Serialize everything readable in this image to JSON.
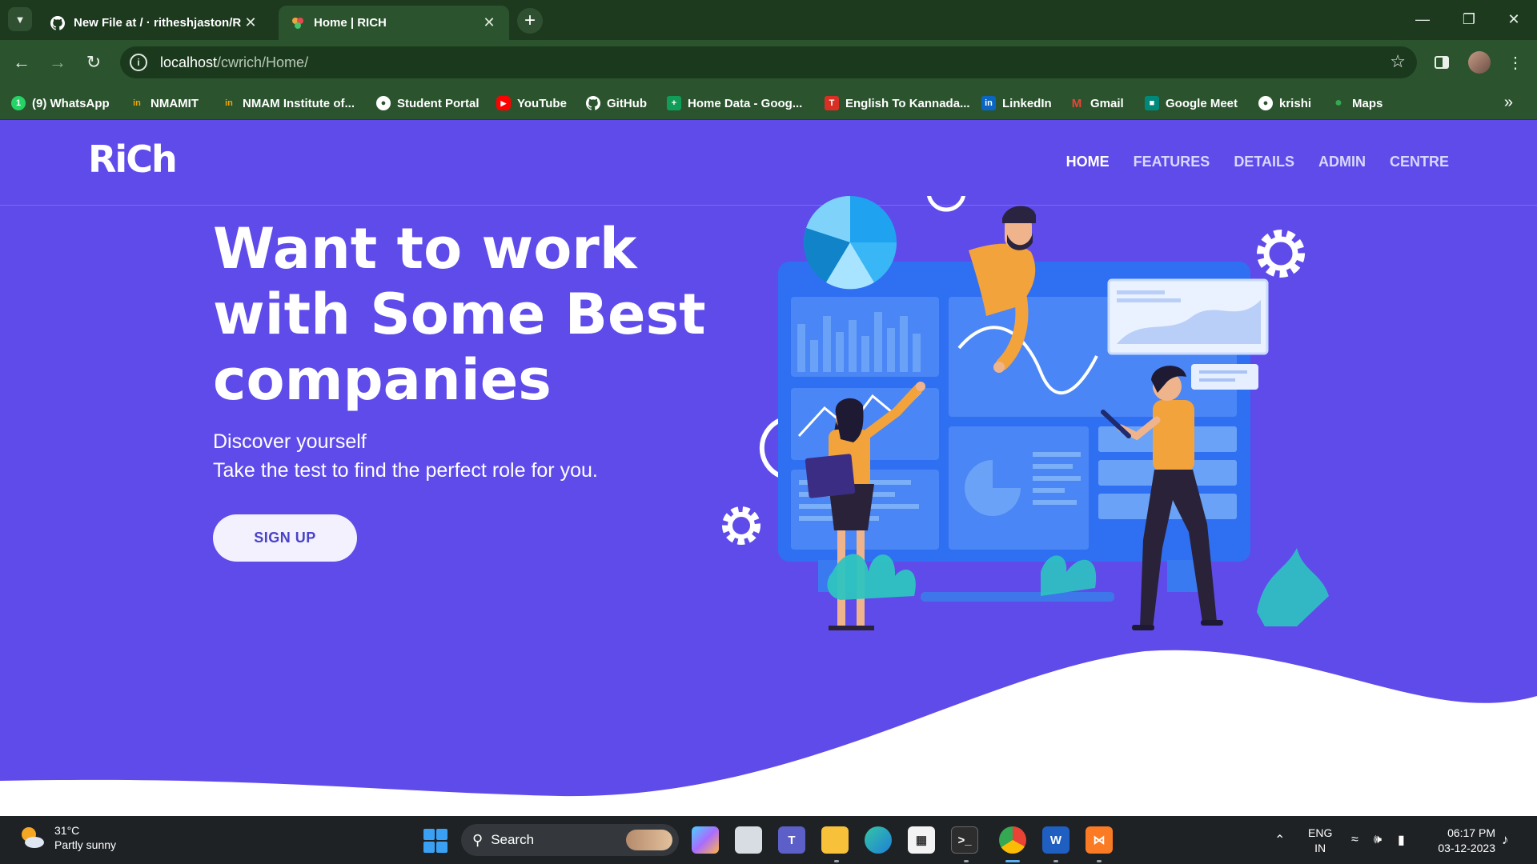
{
  "browser": {
    "tabs": [
      {
        "title": "New File at / · ritheshjaston/Ri",
        "active": false,
        "icon": "github-icon"
      },
      {
        "title": "Home | RICH",
        "active": true,
        "icon": "rich-favicon"
      }
    ],
    "url_host": "localhost",
    "url_path": "/cwrich/Home/",
    "bookmarks": [
      {
        "label": "(9) WhatsApp",
        "icon": "whatsapp-icon",
        "color": "#25d366"
      },
      {
        "label": "NMAMIT",
        "icon": "nmamit-icon",
        "color": "#f0a500"
      },
      {
        "label": "NMAM Institute of...",
        "icon": "nmamit-icon",
        "color": "#f0a500"
      },
      {
        "label": "Student Portal",
        "icon": "globe-icon",
        "color": "#ffffff"
      },
      {
        "label": "YouTube",
        "icon": "youtube-icon",
        "color": "#ff0000"
      },
      {
        "label": "GitHub",
        "icon": "github-icon",
        "color": "#ffffff"
      },
      {
        "label": "Home Data - Goog...",
        "icon": "sheets-icon",
        "color": "#0f9d58"
      },
      {
        "label": "English To Kannada...",
        "icon": "translate-icon",
        "color": "#d93025"
      },
      {
        "label": "LinkedIn",
        "icon": "linkedin-icon",
        "color": "#0a66c2"
      },
      {
        "label": "Gmail",
        "icon": "gmail-icon",
        "color": "#ea4335"
      },
      {
        "label": "Google Meet",
        "icon": "meet-icon",
        "color": "#00897b"
      },
      {
        "label": "krishi",
        "icon": "globe-icon",
        "color": "#ffffff"
      },
      {
        "label": "Maps",
        "icon": "maps-icon",
        "color": "#34a853"
      }
    ]
  },
  "site": {
    "logo": "RiCh",
    "nav": [
      "HOME",
      "FEATURES",
      "DETAILS",
      "ADMIN",
      "CENTRE"
    ],
    "active_nav": "HOME",
    "hero_title": "Want to work with Some Best companies",
    "hero_line1": "Discover yourself",
    "hero_line2": "Take the test to find the perfect role for you.",
    "cta": "SIGN UP",
    "colors": {
      "primary": "#5f4bea",
      "accent": "#1fa2f0",
      "orange": "#f3a33b"
    }
  },
  "taskbar": {
    "weather_temp": "31°C",
    "weather_desc": "Partly sunny",
    "search_placeholder": "Search",
    "lang_top": "ENG",
    "lang_bottom": "IN",
    "time": "06:17 PM",
    "date": "03-12-2023"
  }
}
